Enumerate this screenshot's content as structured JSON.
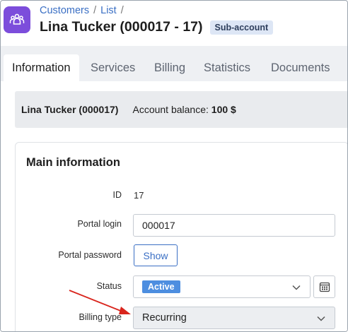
{
  "breadcrumb": {
    "items": [
      "Customers",
      "List"
    ],
    "separator": "/"
  },
  "header": {
    "title": "Lina Tucker (000017 - 17)",
    "badge": "Sub-account"
  },
  "tabs": [
    {
      "label": "Information",
      "active": true
    },
    {
      "label": "Services",
      "active": false
    },
    {
      "label": "Billing",
      "active": false
    },
    {
      "label": "Statistics",
      "active": false
    },
    {
      "label": "Documents",
      "active": false
    }
  ],
  "info_bar": {
    "name": "Lina Tucker (000017)",
    "balance_label": "Account balance:",
    "balance_value": "100 $"
  },
  "main_info": {
    "title": "Main information",
    "id_label": "ID",
    "id_value": "17",
    "portal_login_label": "Portal login",
    "portal_login_value": "000017",
    "portal_password_label": "Portal password",
    "show_label": "Show",
    "status_label": "Status",
    "status_value": "Active",
    "billing_type_label": "Billing type",
    "billing_type_value": "Recurring"
  },
  "colors": {
    "accent": "#3a6fc4",
    "app_icon": "#7c4ddb",
    "status_active": "#4d8ee0",
    "annotation_arrow": "#d9251d"
  },
  "icons": {
    "app": "people-group-icon",
    "chevron": "chevron-down-icon",
    "calendar": "calendar-icon"
  }
}
